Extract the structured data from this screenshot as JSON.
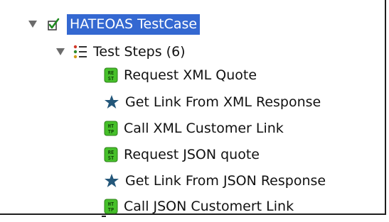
{
  "tree": {
    "testcase": {
      "label": "HATEOAS TestCase",
      "icon": "testcase-checked-icon",
      "expanded": true,
      "selected": true
    },
    "steps_group": {
      "label": "Test Steps (6)",
      "icon": "test-steps-list-icon",
      "expanded": true
    },
    "steps": [
      {
        "label": "Request XML Quote",
        "icon": "rest-request-icon",
        "glyph_top": "RE",
        "glyph_bottom": "ST"
      },
      {
        "label": "Get Link From XML Response",
        "icon": "property-transfer-star-icon"
      },
      {
        "label": "Call XML Customer Link",
        "icon": "http-request-icon",
        "glyph_top": "HT",
        "glyph_bottom": "TP"
      },
      {
        "label": "Request JSON quote",
        "icon": "rest-request-icon",
        "glyph_top": "RE",
        "glyph_bottom": "ST"
      },
      {
        "label": "Get Link From JSON Response",
        "icon": "property-transfer-star-icon"
      },
      {
        "label": "Call JSON Customert Link",
        "icon": "http-request-icon",
        "glyph_top": "HT",
        "glyph_bottom": "TP"
      }
    ]
  },
  "colors": {
    "selection": "#3468d1",
    "step_icon_green": "#46c02a",
    "star_blue": "#24577a",
    "arrow_gray": "#6b6b6b"
  }
}
